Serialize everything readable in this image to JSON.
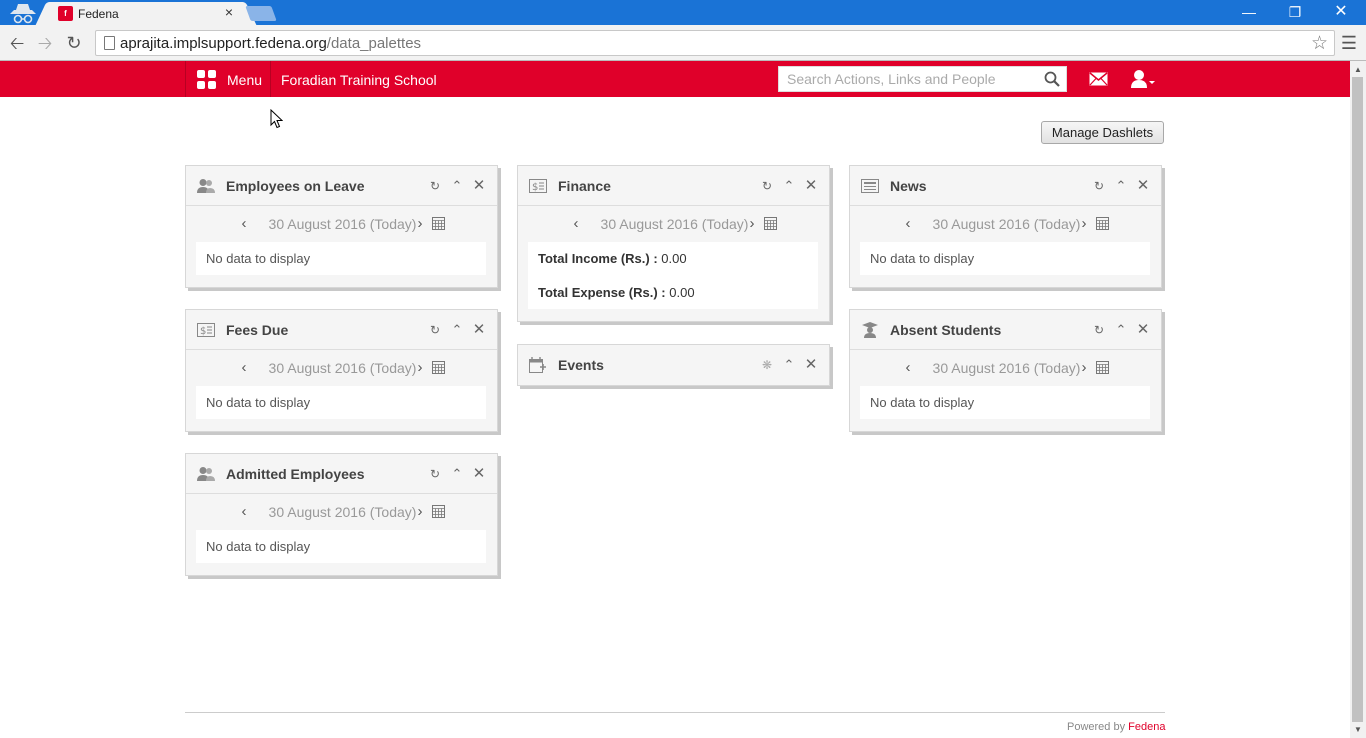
{
  "browser": {
    "tab_title": "Fedena",
    "tab_close": "×",
    "url_host": "aprajita.implsupport.fedena.org",
    "url_path": "/data_palettes"
  },
  "header": {
    "menu_label": "Menu",
    "school_name": "Foradian Training School",
    "search_placeholder": "Search Actions, Links and People",
    "accent_color": "#e0002a"
  },
  "manage_dashlets_label": "Manage Dashlets",
  "date_text": "30 August 2016 (Today)",
  "dashlets": {
    "employees_on_leave": {
      "title": "Employees on Leave",
      "icon": "employees-icon",
      "message": "No data to display"
    },
    "fees_due": {
      "title": "Fees Due",
      "icon": "fees-icon",
      "message": "No data to display"
    },
    "admitted_employees": {
      "title": "Admitted Employees",
      "icon": "employees-icon",
      "message": "No data to display"
    },
    "finance": {
      "title": "Finance",
      "icon": "finance-icon",
      "income_label": "Total Income (Rs.) :",
      "income_value": "0.00",
      "expense_label": "Total Expense (Rs.) :",
      "expense_value": "0.00"
    },
    "events": {
      "title": "Events",
      "icon": "calendar-plus-icon"
    },
    "news": {
      "title": "News",
      "icon": "news-icon",
      "message": "No data to display"
    },
    "absent_students": {
      "title": "Absent Students",
      "icon": "student-icon",
      "message": "No data to display"
    }
  },
  "footer": {
    "powered_by": "Powered by",
    "brand": "Fedena"
  }
}
